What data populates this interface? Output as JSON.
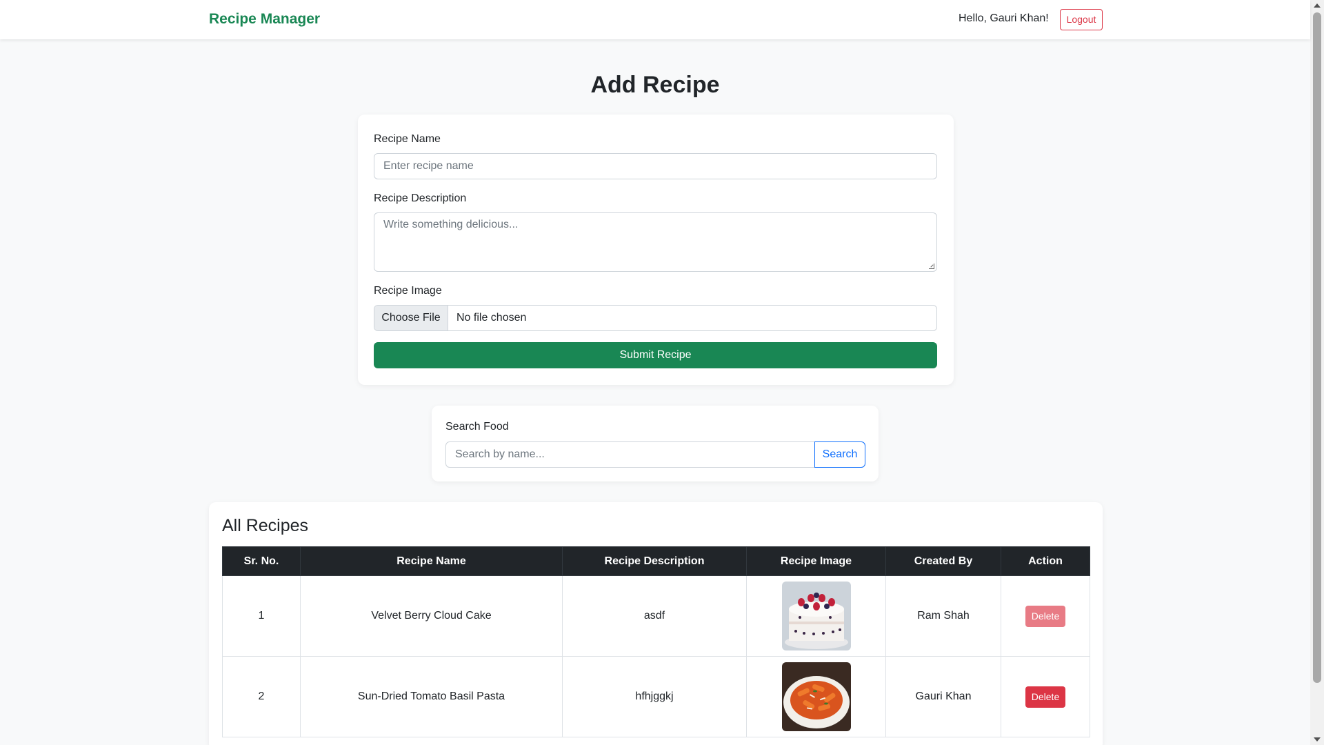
{
  "navbar": {
    "brand": "Recipe Manager",
    "greeting": "Hello, Gauri Khan!",
    "logout_label": "Logout"
  },
  "form": {
    "title": "Add Recipe",
    "name_label": "Recipe Name",
    "name_placeholder": "Enter recipe name",
    "description_label": "Recipe Description",
    "description_placeholder": "Write something delicious...",
    "image_label": "Recipe Image",
    "file_button_label": "Choose File",
    "file_status": "No file chosen",
    "submit_label": "Submit Recipe"
  },
  "search": {
    "label": "Search Food",
    "placeholder": "Search by name...",
    "button_label": "Search"
  },
  "recipes": {
    "title": "All Recipes",
    "columns": [
      "Sr. No.",
      "Recipe Name",
      "Recipe Description",
      "Recipe Image",
      "Created By",
      "Action"
    ],
    "rows": [
      {
        "sr": "1",
        "name": "Velvet Berry Cloud Cake",
        "description": "asdf",
        "image": "berry-cake-photo",
        "created_by": "Ram Shah",
        "action": "Delete",
        "action_enabled": false
      },
      {
        "sr": "2",
        "name": "Sun-Dried Tomato Basil Pasta",
        "description": "hfhjggkj",
        "image": "tomato-pasta-photo",
        "created_by": "Gauri Khan",
        "action": "Delete",
        "action_enabled": true
      }
    ]
  },
  "colors": {
    "brand": "#198754",
    "danger": "#dc3545",
    "primary": "#0d6efd",
    "table_header": "#212529"
  }
}
